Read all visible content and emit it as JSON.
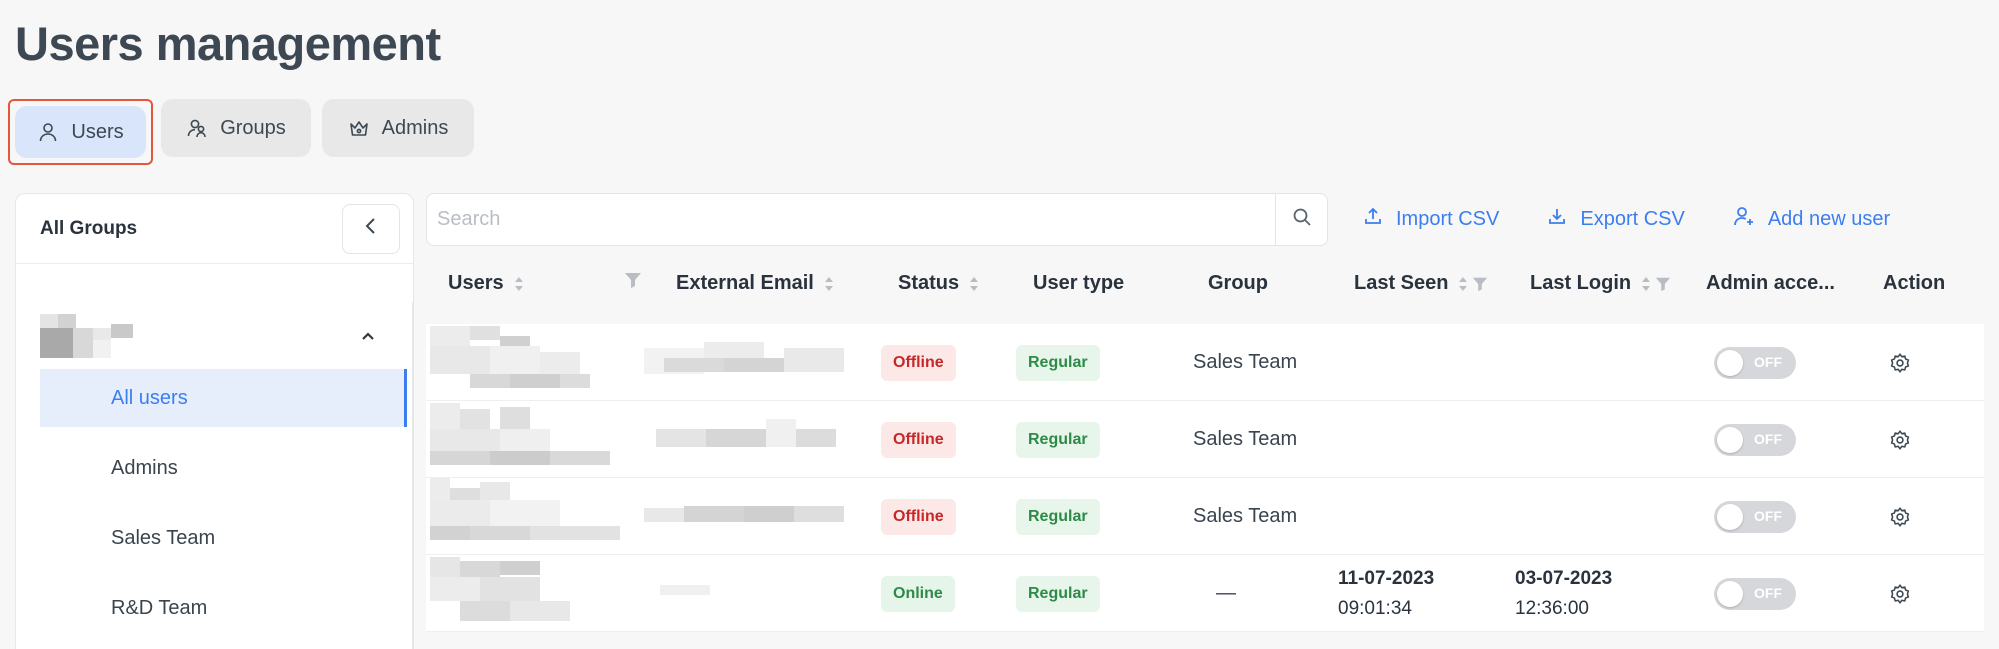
{
  "page": {
    "title": "Users management"
  },
  "tabs": [
    {
      "label": "Users",
      "icon": "user-icon",
      "active": true
    },
    {
      "label": "Groups",
      "icon": "users-group-icon",
      "active": false
    },
    {
      "label": "Admins",
      "icon": "crown-icon",
      "active": false
    }
  ],
  "sidebar": {
    "title": "All Groups",
    "collapse_icon": "chevron-left-icon",
    "group_toggle_icon": "chevron-up-icon",
    "items": [
      {
        "label": "All users",
        "active": true
      },
      {
        "label": "Admins",
        "active": false
      },
      {
        "label": "Sales Team",
        "active": false
      },
      {
        "label": "R&D Team",
        "active": false
      }
    ]
  },
  "search": {
    "placeholder": "Search",
    "value": ""
  },
  "toolbar": {
    "import_label": "Import CSV",
    "export_label": "Export CSV",
    "add_user_label": "Add new user"
  },
  "table": {
    "columns": {
      "users": "Users",
      "external_email": "External Email",
      "status": "Status",
      "user_type": "User type",
      "group": "Group",
      "last_seen": "Last Seen",
      "last_login": "Last Login",
      "admin_access": "Admin acce...",
      "action": "Action"
    },
    "rows": [
      {
        "status": "Offline",
        "user_type": "Regular",
        "group": "Sales Team",
        "last_seen_date": "",
        "last_seen_time": "",
        "last_login_date": "",
        "last_login_time": "",
        "admin_toggle": "OFF"
      },
      {
        "status": "Offline",
        "user_type": "Regular",
        "group": "Sales Team",
        "last_seen_date": "",
        "last_seen_time": "",
        "last_login_date": "",
        "last_login_time": "",
        "admin_toggle": "OFF"
      },
      {
        "status": "Offline",
        "user_type": "Regular",
        "group": "Sales Team",
        "last_seen_date": "",
        "last_seen_time": "",
        "last_login_date": "",
        "last_login_time": "",
        "admin_toggle": "OFF"
      },
      {
        "status": "Online",
        "user_type": "Regular",
        "group": "—",
        "last_seen_date": "11-07-2023",
        "last_seen_time": "09:01:34",
        "last_login_date": "03-07-2023",
        "last_login_time": "12:36:00",
        "admin_toggle": "OFF"
      }
    ]
  },
  "colors": {
    "accent": "#3c7ef0",
    "offline": "#c62828",
    "online": "#2e8b47",
    "highlight_border": "#e4573d"
  }
}
